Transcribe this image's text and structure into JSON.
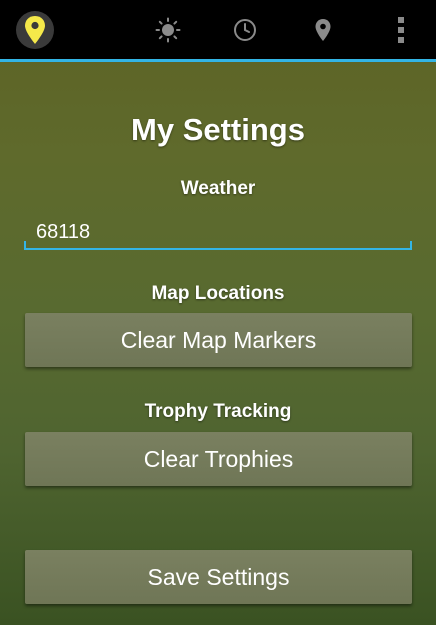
{
  "action_bar": {
    "icons": [
      "app-location-icon",
      "sun-icon",
      "clock-icon",
      "map-pin-icon",
      "overflow-menu-icon"
    ],
    "accent_color": "#33b5e5",
    "app_icon_color": "#f5e94a"
  },
  "page": {
    "title": "My Settings"
  },
  "weather": {
    "label": "Weather",
    "zip_value": "68118"
  },
  "map_locations": {
    "label": "Map Locations",
    "clear_button": "Clear Map Markers"
  },
  "trophy_tracking": {
    "label": "Trophy Tracking",
    "clear_button": "Clear Trophies"
  },
  "save_button": "Save Settings"
}
